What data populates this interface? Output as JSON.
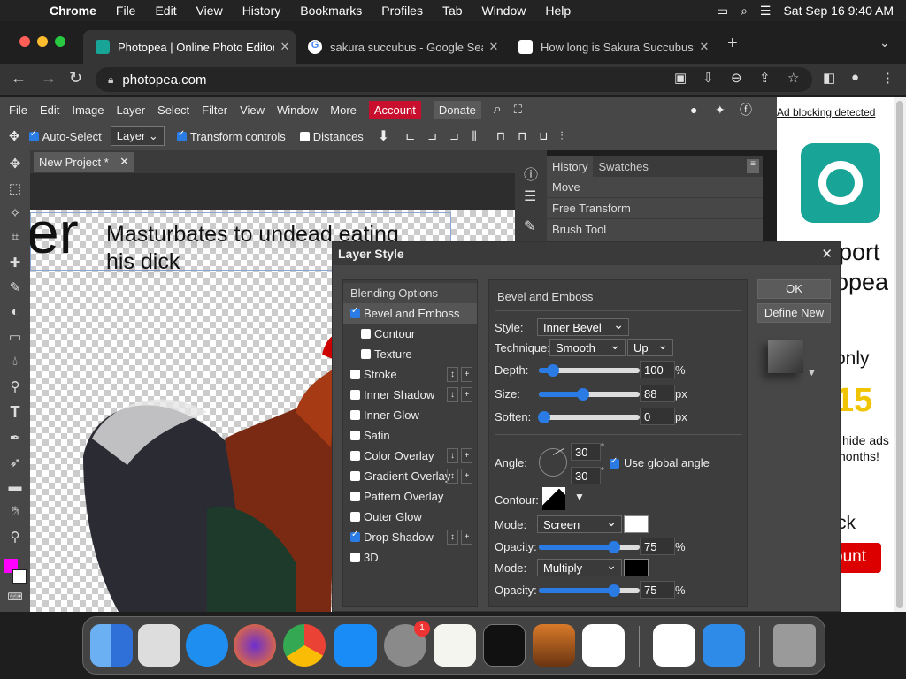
{
  "menubar": {
    "app": "Chrome",
    "items": [
      "File",
      "Edit",
      "View",
      "History",
      "Bookmarks",
      "Profiles",
      "Tab",
      "Window",
      "Help"
    ],
    "datetime": "Sat Sep 16  9:40 AM"
  },
  "tabs": [
    {
      "title": "Photopea | Online Photo Editor",
      "active": true
    },
    {
      "title": "sakura succubus - Google Sear",
      "active": false
    },
    {
      "title": "How long is Sakura Succubus?",
      "active": false
    }
  ],
  "address": {
    "url": "photopea.com"
  },
  "pp_menu": [
    "File",
    "Edit",
    "Image",
    "Layer",
    "Select",
    "Filter",
    "View",
    "Window",
    "More"
  ],
  "pp_account": "Account",
  "pp_donate": "Donate",
  "options": {
    "auto_select": "Auto-Select",
    "layer_select": "Layer",
    "transform_controls": "Transform controls",
    "distances": "Distances"
  },
  "doc_tab": "New Project *",
  "canvas_text": {
    "big": "er",
    "line1": "Masturbates to undead eating",
    "line2": "his dick"
  },
  "history": {
    "tabs": [
      "History",
      "Swatches"
    ],
    "items": [
      "Move",
      "Free Transform",
      "Brush Tool"
    ]
  },
  "ad": {
    "link": "Ad blocking detected",
    "text1": "port",
    "text2": "opea",
    "text3": "only",
    "text4": "15",
    "text5": "hide ads",
    "text6": "nonths!",
    "text7": "ck",
    "button": "ount"
  },
  "dialog": {
    "title": "Layer Style",
    "list": [
      {
        "label": "Blending Options",
        "check": null
      },
      {
        "label": "Bevel and Emboss",
        "check": true
      },
      {
        "label": "Contour",
        "check": false,
        "indent": true
      },
      {
        "label": "Texture",
        "check": false,
        "indent": true
      },
      {
        "label": "Stroke",
        "check": false,
        "plus": true
      },
      {
        "label": "Inner Shadow",
        "check": false,
        "plus": true
      },
      {
        "label": "Inner Glow",
        "check": false
      },
      {
        "label": "Satin",
        "check": false
      },
      {
        "label": "Color Overlay",
        "check": false,
        "plus": true
      },
      {
        "label": "Gradient Overlay",
        "check": false,
        "plus": true
      },
      {
        "label": "Pattern Overlay",
        "check": false
      },
      {
        "label": "Outer Glow",
        "check": false
      },
      {
        "label": "Drop Shadow",
        "check": true,
        "plus": true
      },
      {
        "label": "3D",
        "check": false
      }
    ],
    "section": "Bevel and Emboss",
    "style_label": "Style:",
    "style": "Inner Bevel",
    "technique_label": "Technique:",
    "technique": "Smooth",
    "direction": "Up",
    "depth_label": "Depth:",
    "depth": "100",
    "size_label": "Size:",
    "size": "88",
    "soften_label": "Soften:",
    "soften": "0",
    "angle_label": "Angle:",
    "angle": "30",
    "altitude": "30",
    "global_angle": "Use global angle",
    "contour_label": "Contour:",
    "mode_label": "Mode:",
    "highlight_mode": "Screen",
    "opacity_label": "Opacity:",
    "highlight_opacity": "75",
    "shadow_mode": "Multiply",
    "shadow_opacity": "75",
    "pct": "%",
    "px": "px",
    "ok": "OK",
    "define_new": "Define New"
  },
  "colors": {
    "accent": "#2a7be4",
    "account": "#c8102e",
    "highlight": "#ffffff",
    "shadow": "#000000",
    "fg": "#ff00ff"
  }
}
